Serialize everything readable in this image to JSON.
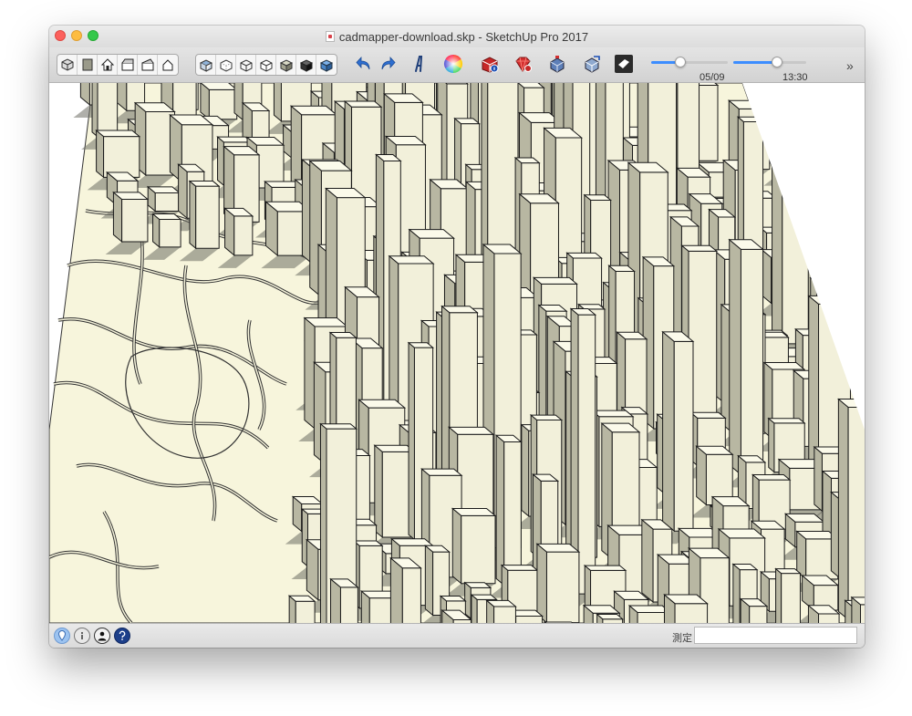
{
  "window": {
    "title": "cadmapper-download.skp - SketchUp Pro 2017"
  },
  "toolbar": {
    "group_views": [
      "iso-view-icon",
      "top-view-icon",
      "front-view-icon",
      "right-view-icon",
      "back-view-icon",
      "left-view-icon"
    ],
    "group_styles": [
      "xray-style-icon",
      "back-edges-style-icon",
      "wireframe-style-icon",
      "hidden-line-style-icon",
      "shaded-style-icon",
      "shaded-texture-style-icon",
      "monochrome-style-icon"
    ],
    "shadow_date": {
      "value": "05/09",
      "fraction": 0.38
    },
    "shadow_time": {
      "value": "13:30",
      "fraction": 0.6
    }
  },
  "statusbar": {
    "measurements_label": "測定",
    "measurements_value": ""
  },
  "colors": {
    "building_face": "#f2f0da",
    "building_side": "#b8b7a2",
    "building_shadow": "#6e6e64",
    "ground": "#f7f5dc",
    "accent_blue": "#3c8dff"
  }
}
